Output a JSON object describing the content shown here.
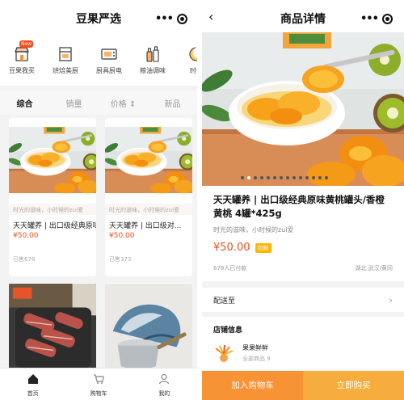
{
  "home": {
    "title": "豆果严选",
    "capsule_dots": "•••",
    "categories": [
      {
        "label": "豆果我买",
        "icon": "store-icon",
        "badge": "New"
      },
      {
        "label": "烘焙美厨",
        "icon": "oven-icon"
      },
      {
        "label": "厨具厨电",
        "icon": "microwave-icon"
      },
      {
        "label": "粮油调味",
        "icon": "bottles-icon"
      },
      {
        "label": "时令",
        "icon": "moon-icon"
      }
    ],
    "sort": [
      "综合",
      "销量",
      "价格 ⇕",
      "新品"
    ],
    "products": [
      {
        "slogan": "时光的滋味，小时候的zui爱",
        "name": "天天罐养 | 出口级经典原味黄桃罐头",
        "price": "¥50.00",
        "sold": "已售678"
      },
      {
        "slogan": "时光的滋味，小时候的zui爱",
        "name": "天天罐养 | 出口级对...",
        "price": "¥50.00",
        "sold": "已售373"
      }
    ],
    "tabs": [
      {
        "label": "首页",
        "icon": "home-icon"
      },
      {
        "label": "购物车",
        "icon": "cart-icon"
      },
      {
        "label": "我的",
        "icon": "user-icon"
      }
    ]
  },
  "detail": {
    "title": "商品详情",
    "back": "‹",
    "capsule_dots": "•••",
    "product_title": "天天罐养 | 出口级经典原味黄桃罐头/香橙黄桃 4罐*425g",
    "slogan": "时光的滋味，小时候的zui爱",
    "price": "¥50.00",
    "tag": "包邮",
    "paid": "678人已付款",
    "location": "湖北 武汉/黄冈",
    "shipping_label": "配送至",
    "chevron": "›",
    "shop_heading": "店铺信息",
    "shop_name": "果果鲜鲜",
    "shop_count": "全部商品 9",
    "add_to_cart": "加入购物车",
    "buy_now": "立即购买",
    "carousel_dots": 14,
    "carousel_active": 1
  },
  "colors": {
    "accent_price": "#e8541e",
    "cart_button": "#f79235",
    "buy_button": "#f7ad3d",
    "tag_bg": "#ffb400"
  }
}
